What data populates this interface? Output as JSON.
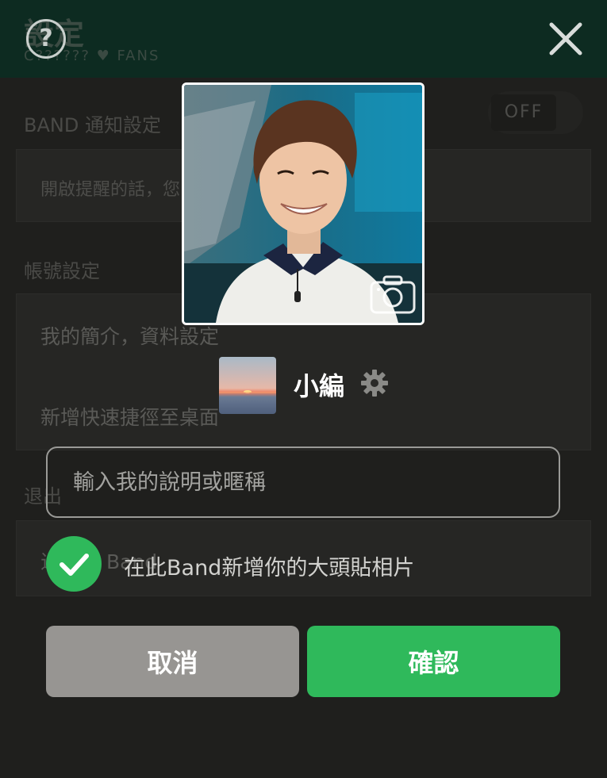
{
  "background": {
    "title": "設定",
    "subtitle": "C?????? ♥ FANS",
    "notify_section": "BAND 通知設定",
    "toggle_state": "OFF",
    "notify_desc": "開啟提醒的話，您……聊天提醒",
    "account_section": "帳號設定",
    "profile_item": "我的簡介，資料設定",
    "shortcut_item": "新增快速捷徑至桌面",
    "exit_section": "退出",
    "exit_item": "退出此 Band"
  },
  "dialog": {
    "nickname": "小編",
    "description_placeholder": "輸入我的說明或暱稱",
    "add_photo_label": "在此Band新增你的大頭貼相片",
    "add_photo_checked": true,
    "cancel_label": "取消",
    "confirm_label": "確認"
  },
  "colors": {
    "accent_green": "#2fb95b",
    "cancel_gray": "#979592",
    "header_dark_green": "#0d2b21"
  },
  "icons": [
    "help-icon",
    "close-icon",
    "camera-icon",
    "gear-icon",
    "check-icon"
  ]
}
